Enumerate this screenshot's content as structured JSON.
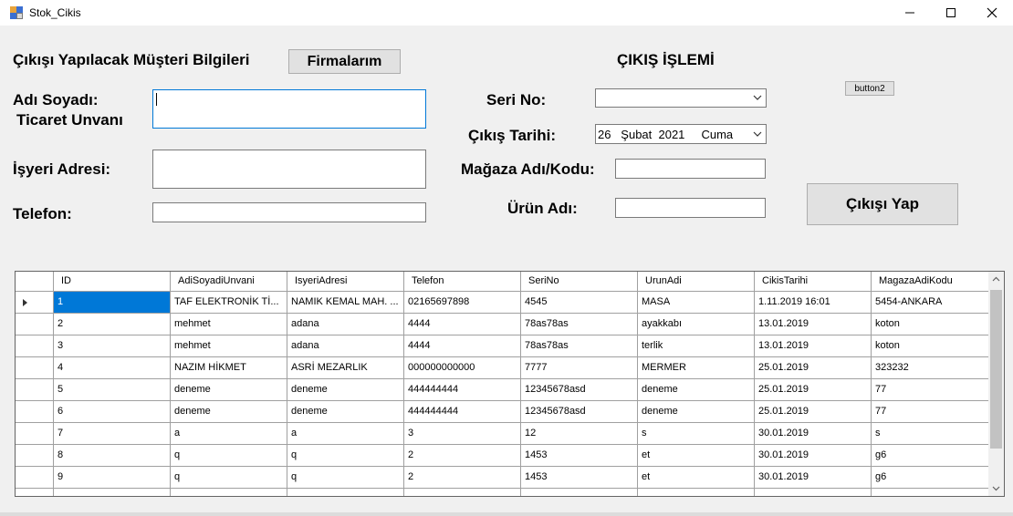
{
  "window": {
    "title": "Stok_Cikis"
  },
  "left": {
    "section_title": "Çıkışı Yapılacak Müşteri Bilgileri",
    "firmalarim_button": "Firmalarım",
    "ad_soyad_label_line1": "Adı Soyadı:",
    "ad_soyad_label_line2": "Ticaret Unvanı",
    "adres_label": "İşyeri Adresi:",
    "telefon_label": "Telefon:"
  },
  "right": {
    "section_title": "ÇIKIŞ İŞLEMİ",
    "seri_no_label": "Seri No:",
    "seri_no_value": "",
    "cikis_tarihi_label": "Çıkış Tarihi:",
    "cikis_tarihi_value": "26   Şubat  2021     Cuma",
    "magaza_label": "Mağaza Adı/Kodu:",
    "urun_label": "Ürün Adı:",
    "button2_label": "button2",
    "cikisi_yap_button": "Çıkışı Yap"
  },
  "grid": {
    "columns": [
      "ID",
      "AdiSoyadiUnvani",
      "IsyeriAdresi",
      "Telefon",
      "SeriNo",
      "UrunAdi",
      "CikisTarihi",
      "MagazaAdiKodu"
    ],
    "rows": [
      [
        "1",
        "TAF ELEKTRONİK Tİ...",
        "NAMIK KEMAL MAH. ...",
        "02165697898",
        "4545",
        "MASA",
        "1.11.2019 16:01",
        "5454-ANKARA"
      ],
      [
        "2",
        "mehmet",
        "adana",
        "4444",
        "78as78as",
        "ayakkabı",
        "13.01.2019",
        "koton"
      ],
      [
        "3",
        "mehmet",
        "adana",
        "4444",
        "78as78as",
        "terlik",
        "13.01.2019",
        "koton"
      ],
      [
        "4",
        "NAZIM HİKMET",
        "ASRİ MEZARLIK",
        "000000000000",
        "7777",
        "MERMER",
        "25.01.2019",
        "323232"
      ],
      [
        "5",
        "deneme",
        "deneme",
        "444444444",
        "12345678asd",
        "deneme",
        "25.01.2019",
        "77"
      ],
      [
        "6",
        "deneme",
        "deneme",
        "444444444",
        "12345678asd",
        "deneme",
        "25.01.2019",
        "77"
      ],
      [
        "7",
        "a",
        "a",
        "3",
        "12",
        "s",
        "30.01.2019",
        "s"
      ],
      [
        "8",
        "q",
        "q",
        "2",
        "1453",
        "et",
        "30.01.2019",
        "g6"
      ],
      [
        "9",
        "q",
        "q",
        "2",
        "1453",
        "et",
        "30.01.2019",
        "g6"
      ]
    ]
  },
  "colors": {
    "selection": "#0078d7",
    "focus_border": "#0078d7",
    "background": "#f0f0f0"
  },
  "icons": [
    "app-icon",
    "minimize-icon",
    "maximize-icon",
    "close-icon",
    "chevron-down-icon",
    "row-pointer-icon",
    "scroll-up-icon",
    "scroll-down-icon"
  ]
}
